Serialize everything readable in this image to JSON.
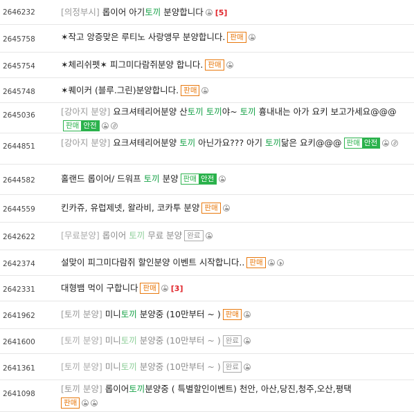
{
  "posts": [
    {
      "id": "2646232",
      "category": "[의정부시]",
      "pre": " 롭이어 아기",
      "kw": "토끼",
      "post": " 분양합니다",
      "kw2": "",
      "post2": "",
      "icons": [
        "photo"
      ],
      "comments": "[5]"
    },
    {
      "id": "2645758",
      "title": "✶작고 앙증맞은 루티노 사랑앵무 분양합니다.",
      "badge": "판매",
      "icons": [
        "photo"
      ]
    },
    {
      "id": "2645754",
      "title": "✶체리쉬펫✶ 피그미다람쥐분양 합니다.",
      "badge": "판매",
      "icons": [
        "photo"
      ]
    },
    {
      "id": "2645748",
      "title": "✶퀘이커 (블루.그린)분양합니다.",
      "badge": "판매",
      "icons": [
        "photo"
      ]
    },
    {
      "id": "2645036",
      "category": "[강아지 분양]",
      "pre": " 요크셔테리어분양 산",
      "kw": "토끼",
      "mid": " ",
      "kw2": "토끼",
      "post": "야~ ",
      "kw3": "토끼",
      "post2": " 흉내내는 아가 요키 보고가세요@@@",
      "badge1": "판매",
      "badge2": "안전",
      "icons": [
        "photo",
        "clip"
      ]
    },
    {
      "id": "2644851",
      "category": "[강아지 분양]",
      "pre": " 요크셔테리어분양 ",
      "kw": "토끼",
      "post": " 아닌가요??? 아기 ",
      "kw2": "토끼",
      "post2": "닮은 요키@@@",
      "badge1": "판매",
      "badge2": "안전",
      "icons": [
        "photo",
        "clip"
      ]
    },
    {
      "id": "2644582",
      "pre": "홀랜드 롭이어/ 드워프 ",
      "kw": "토끼",
      "post": " 분양",
      "badge1": "판매",
      "badge2": "안전",
      "icons": [
        "photo"
      ]
    },
    {
      "id": "2644559",
      "title": "킨카쥬, 유럽제넷, 왈라비, 코카투 분양",
      "badge": "판매",
      "icons": [
        "photo"
      ]
    },
    {
      "id": "2642622",
      "category": "[무료분양]",
      "pre": " 롭이어 ",
      "kw": "토끼",
      "post": " 무료 분양",
      "badge": "완료",
      "icons": [
        "photo"
      ]
    },
    {
      "id": "2642374",
      "title": "설맞이 피그미다람쥐 할인분양 이벤트 시작합니다..",
      "badge": "판매",
      "icons": [
        "photo",
        "play"
      ]
    },
    {
      "id": "2642331",
      "title": "대형뱀 먹이 구합니다",
      "badge": "판매",
      "icons": [
        "photo"
      ],
      "comments": "[3]"
    },
    {
      "id": "2641962",
      "category": "[토끼 분양]",
      "pre": " 미니",
      "kw": "토끼",
      "post": " 분양중 (10만부터 ~ )",
      "badge": "판매",
      "icons": [
        "photo"
      ]
    },
    {
      "id": "2641600",
      "category": "[토끼 분양]",
      "pre": " 미니",
      "kw": "토끼",
      "post": " 분양중 (10만부터 ~ )",
      "badge": "완료",
      "icons": [
        "photo"
      ]
    },
    {
      "id": "2641361",
      "category": "[토끼 분양]",
      "pre": " 미니",
      "kw": "토끼",
      "post": " 분양중 (10만부터 ~ )",
      "badge": "완료",
      "icons": [
        "photo"
      ]
    },
    {
      "id": "2641098",
      "category": "[토끼 분양]",
      "pre": " 롭이어",
      "kw": "토끼",
      "post": "분양중 ( 특별할인이벤트) 천안, 아산,당진,청주,오산,평택",
      "badge": "판매",
      "icons": [
        "photo",
        "photo"
      ]
    }
  ],
  "colors": {
    "keyword": "#1aa34a",
    "sell": "#e8780c",
    "safe": "#2bb24c",
    "count": "#e0242a"
  }
}
